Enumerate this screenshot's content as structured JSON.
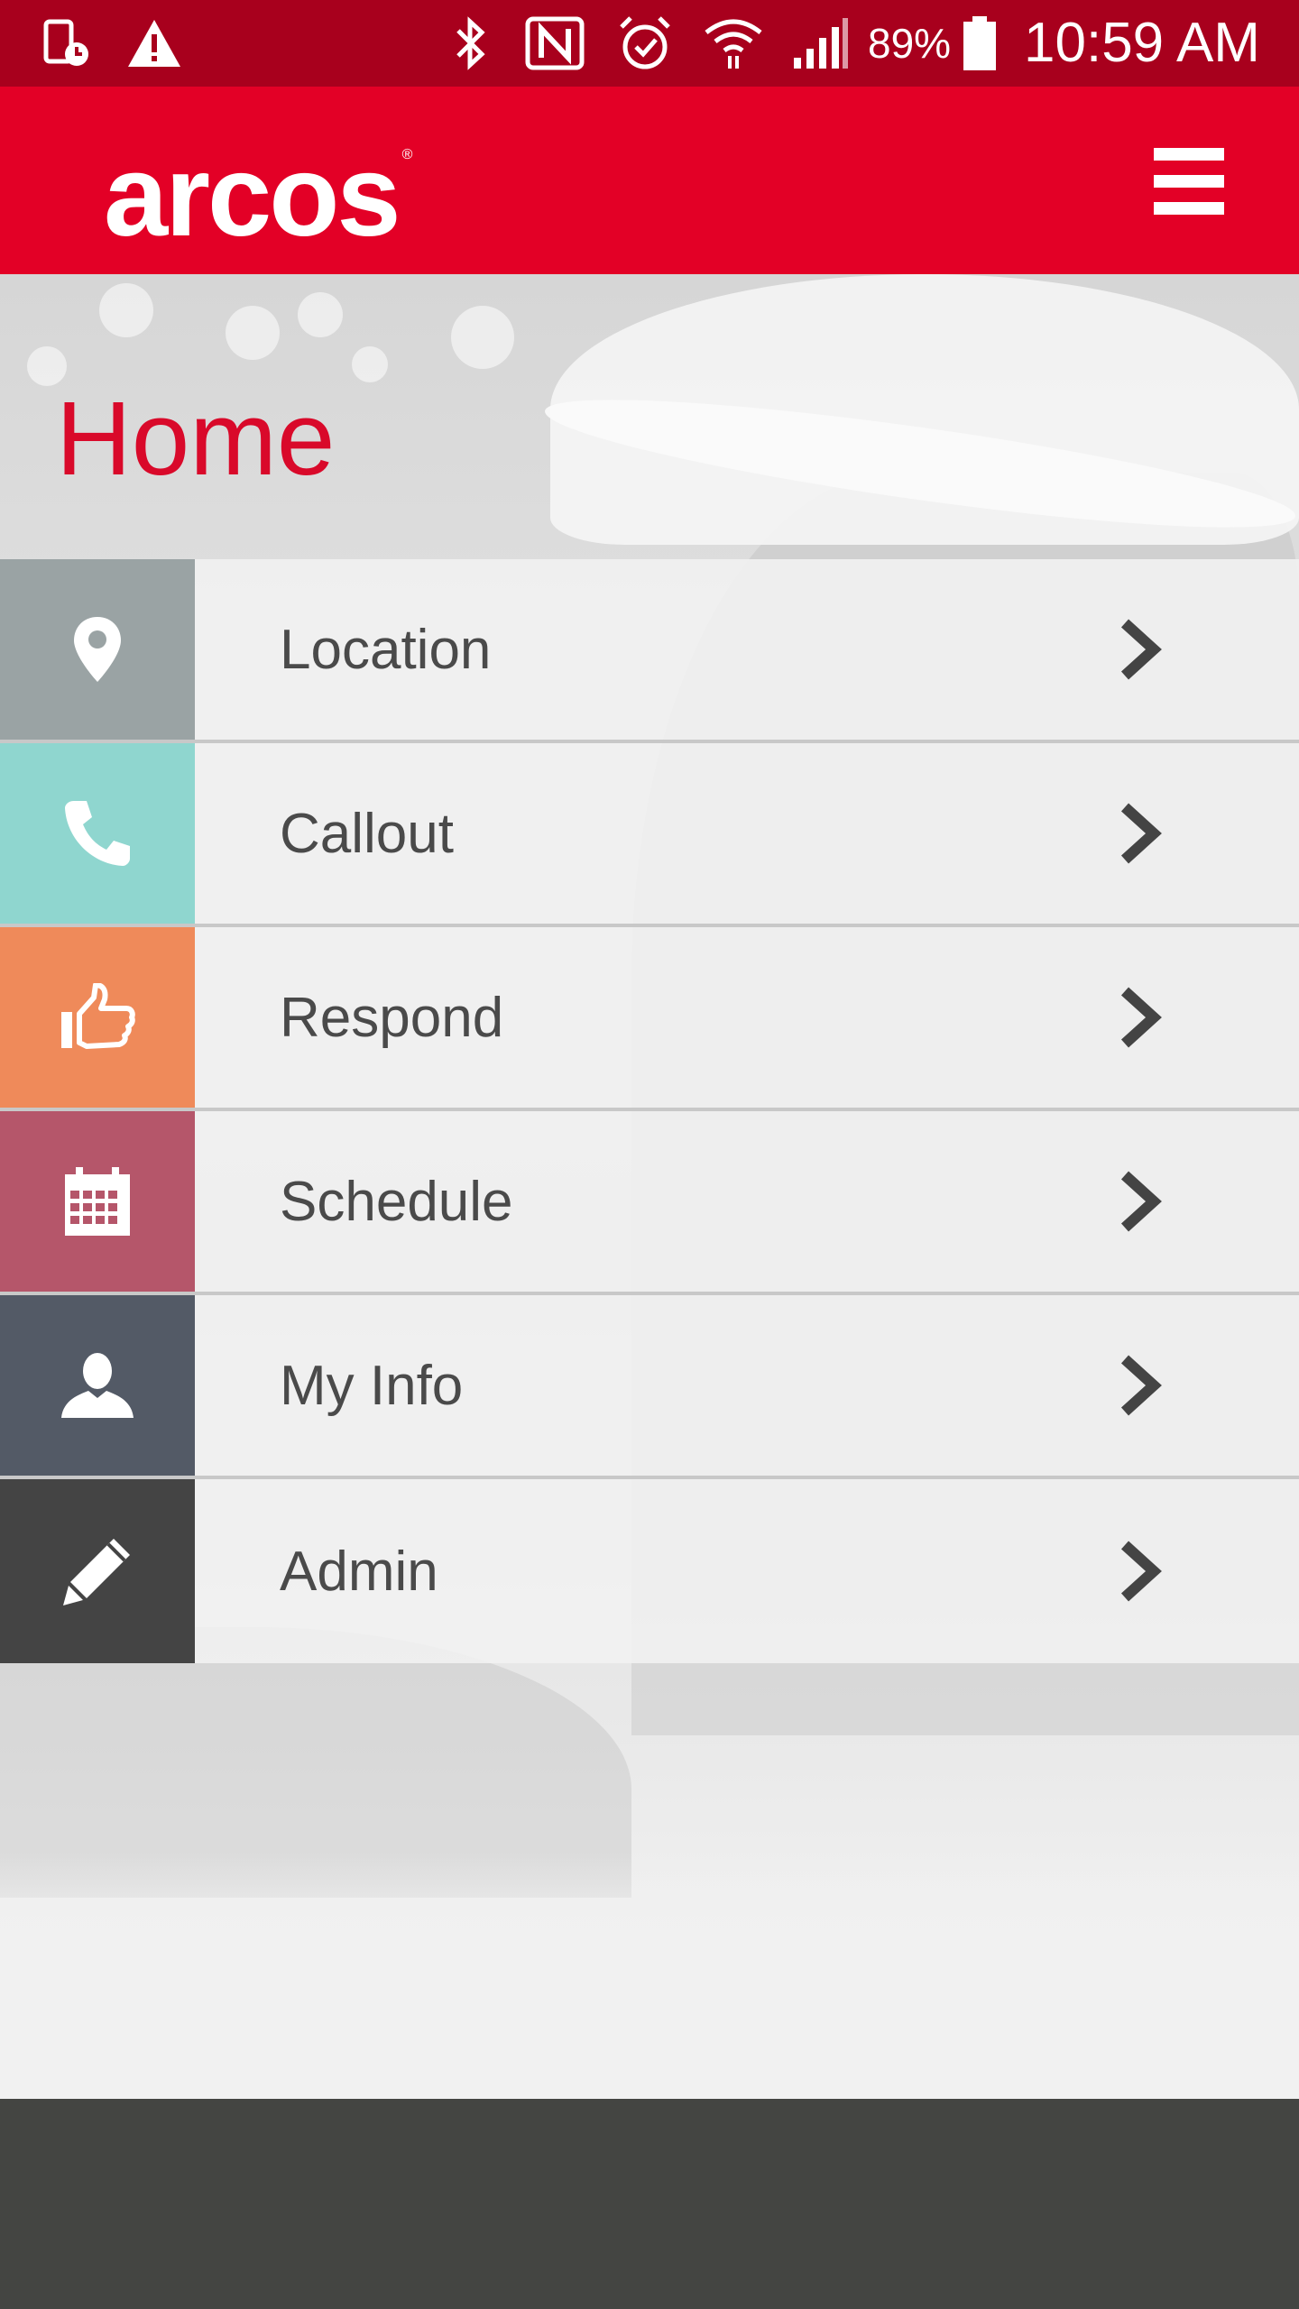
{
  "status_bar": {
    "battery_percent": "89%",
    "time": "10:59 AM",
    "icons": [
      "device-clock-icon",
      "warning-icon",
      "bluetooth-icon",
      "nfc-icon",
      "alarm-icon",
      "wifi-icon",
      "signal-icon",
      "battery-icon"
    ]
  },
  "header": {
    "logo_text": "arcos",
    "logo_mark": "®",
    "menu_icon": "hamburger-menu-icon"
  },
  "page": {
    "title": "Home"
  },
  "menu": {
    "items": [
      {
        "label": "Location",
        "icon": "map-pin-icon",
        "color": "#9aa3a4"
      },
      {
        "label": "Callout",
        "icon": "phone-icon",
        "color": "#8fd6cf"
      },
      {
        "label": "Respond",
        "icon": "thumbs-up-icon",
        "color": "#ef8a5a"
      },
      {
        "label": "Schedule",
        "icon": "calendar-icon",
        "color": "#b5566a"
      },
      {
        "label": "My Info",
        "icon": "user-icon",
        "color": "#535a66"
      },
      {
        "label": "Admin",
        "icon": "pencil-icon",
        "color": "#444444"
      }
    ]
  },
  "colors": {
    "status_bar": "#a8001d",
    "brand_red": "#e30026",
    "title_red": "#d9092a",
    "footer": "#444542"
  }
}
